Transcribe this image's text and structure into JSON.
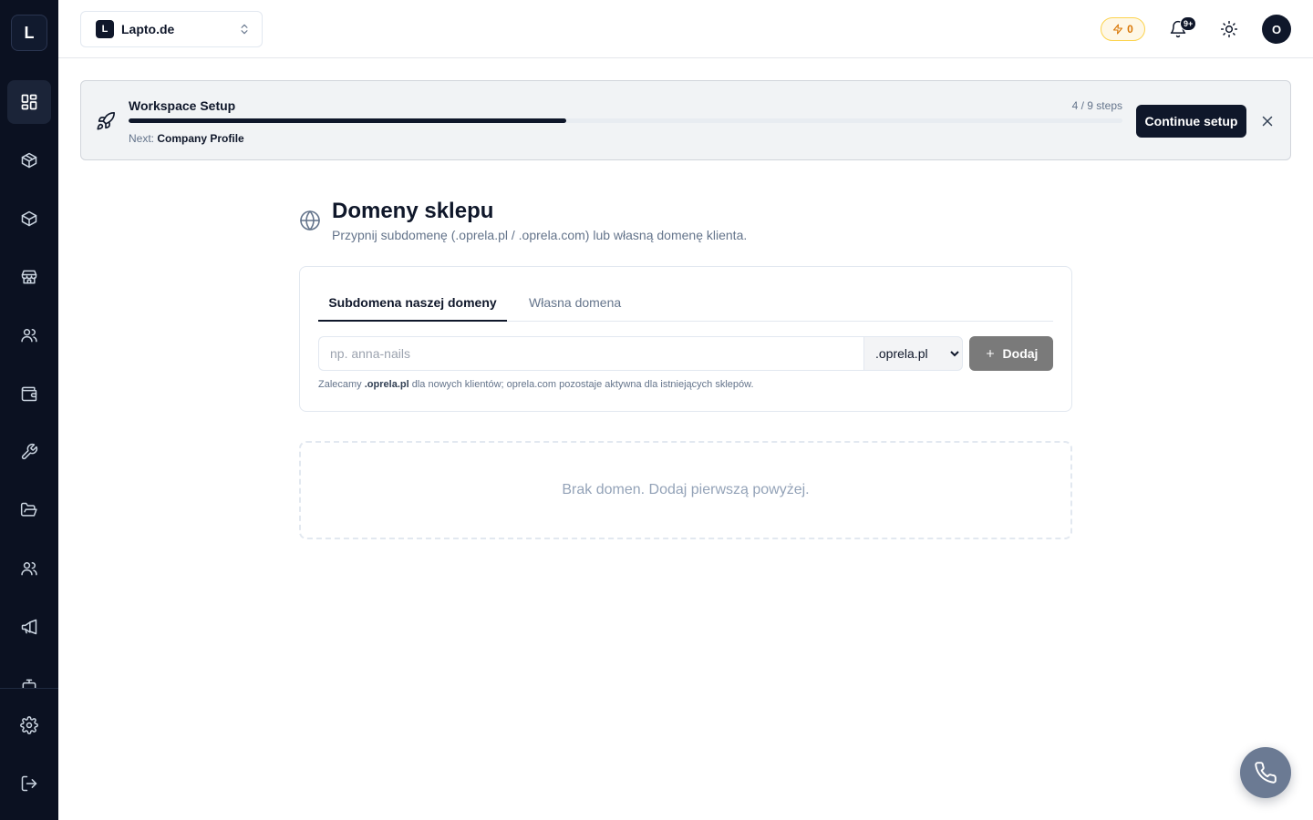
{
  "sidebar": {
    "logo_letter": "L",
    "items": [
      {
        "icon": "dashboard-icon",
        "active": true
      },
      {
        "icon": "package-icon"
      },
      {
        "icon": "box-icon"
      },
      {
        "icon": "store-icon"
      },
      {
        "icon": "users-icon"
      },
      {
        "icon": "wallet-icon"
      },
      {
        "icon": "wrench-icon"
      },
      {
        "icon": "folder-open-icon"
      },
      {
        "icon": "team-icon"
      },
      {
        "icon": "megaphone-icon"
      }
    ],
    "bottom_items": [
      {
        "icon": "settings-icon"
      },
      {
        "icon": "logout-icon"
      }
    ]
  },
  "header": {
    "workspace_badge": "L",
    "workspace_name": "Lapto.de",
    "credits": "0",
    "notifications_badge": "9+",
    "avatar_letter": "O"
  },
  "setup_banner": {
    "title": "Workspace Setup",
    "steps_text": "4 / 9 steps",
    "progress": 0.44,
    "next_label": "Next:",
    "next_value": "Company Profile",
    "continue_label": "Continue setup"
  },
  "page": {
    "title": "Domeny sklepu",
    "subtitle": "Przypnij subdomenę (.oprela.pl / .oprela.com) lub własną domenę klienta."
  },
  "domain_card": {
    "tabs": [
      {
        "label": "Subdomena naszej domeny",
        "active": true
      },
      {
        "label": "Własna domena",
        "active": false
      }
    ],
    "input_value": "",
    "input_placeholder": "np. anna-nails",
    "selected_domain": ".oprela.pl",
    "add_label": "Dodaj",
    "hint_prefix": "Zalecamy",
    "hint_strong": ".oprela.pl",
    "hint_suffix": "dla nowych klientów; oprela.com pozostaje aktywna dla istniejących sklepów."
  },
  "empty_state": {
    "text": "Brak domen. Dodaj pierwszą powyżej."
  },
  "colors": {
    "sidebar_bg": "#0b1121",
    "primary": "#0f172a",
    "credits_accent": "#d97706",
    "add_button_disabled": "#7a7a7a",
    "call_button": "#6b7a93"
  }
}
